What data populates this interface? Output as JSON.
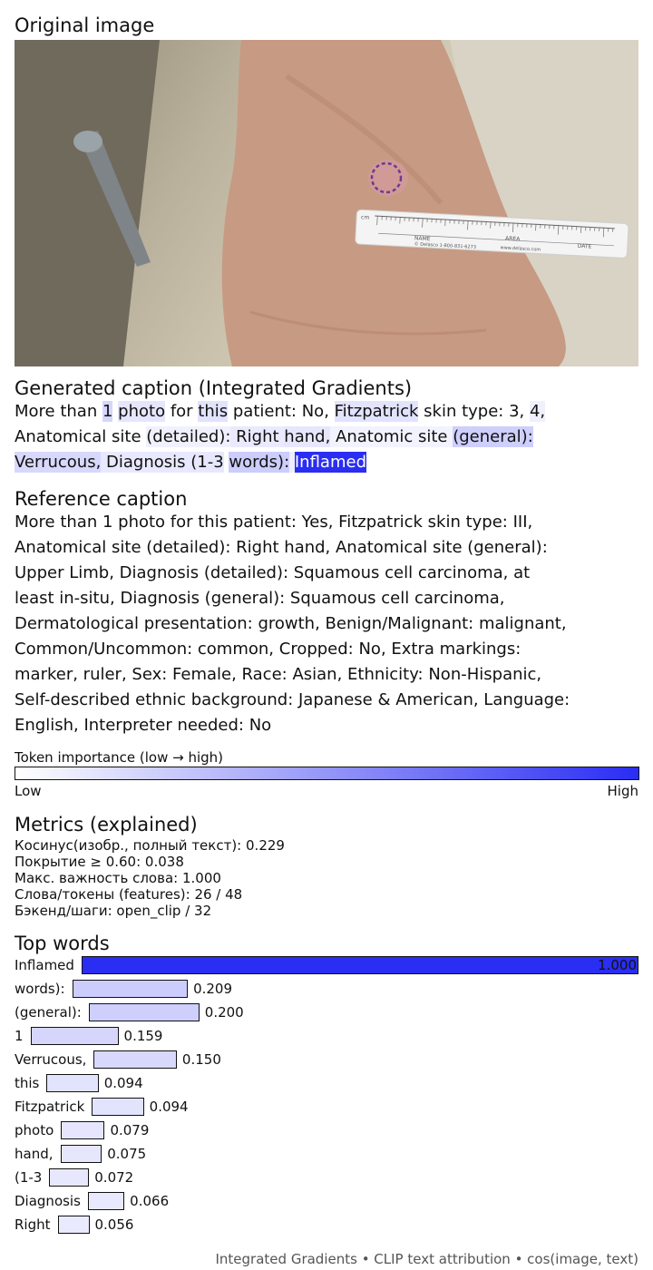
{
  "titles": {
    "original": "Original image",
    "generated": "Generated caption (Integrated Gradients)",
    "reference": "Reference caption",
    "metrics": "Metrics (explained)",
    "top_words": "Top words"
  },
  "generated_caption": {
    "lines": [
      [
        {
          "text": "More than ",
          "w": 0
        },
        {
          "text": "1",
          "w": 0.159
        },
        {
          "text": " ",
          "w": 0
        },
        {
          "text": "photo",
          "w": 0.079
        },
        {
          "text": " for ",
          "w": 0
        },
        {
          "text": "this",
          "w": 0.094
        },
        {
          "text": " patient: No, ",
          "w": 0
        },
        {
          "text": "Fitzpatrick",
          "w": 0.094
        },
        {
          "text": " skin type: 3, ",
          "w": 0
        },
        {
          "text": "4,",
          "w": 0.03
        }
      ],
      [
        {
          "text": "Anatomical site ",
          "w": 0
        },
        {
          "text": "(detailed):",
          "w": 0.02
        },
        {
          "text": " Right ",
          "w": 0.056
        },
        {
          "text": "hand,",
          "w": 0.075
        },
        {
          "text": " Anatomic site ",
          "w": 0.01
        },
        {
          "text": "(general):",
          "w": 0.2
        }
      ],
      [
        {
          "text": "Verrucous,",
          "w": 0.15
        },
        {
          "text": " Diagnosis ",
          "w": 0.066
        },
        {
          "text": "(1-3",
          "w": 0.072
        },
        {
          "text": " ",
          "w": 0
        },
        {
          "text": "words):",
          "w": 0.209
        },
        {
          "text": " ",
          "w": 0.04
        },
        {
          "text": "Inflamed",
          "w": 1.0
        }
      ]
    ]
  },
  "reference_caption": {
    "lines": [
      "More than 1 photo for this patient: Yes, Fitzpatrick skin type: III,",
      "Anatomical site (detailed): Right hand, Anatomical site (general):",
      "Upper Limb, Diagnosis (detailed): Squamous cell carcinoma, at",
      "least in-situ, Diagnosis (general): Squamous cell carcinoma,",
      "Dermatological presentation: growth, Benign/Malignant: malignant,",
      "Common/Uncommon: common, Cropped: No, Extra markings:",
      "marker, ruler, Sex: Female, Race: Asian, Ethnicity: Non-Hispanic,",
      "Self-described ethnic background: Japanese & American, Language:",
      "English, Interpreter needed: No"
    ]
  },
  "scale": {
    "label": "Token importance (low → high)",
    "low": "Low",
    "high": "High",
    "low_color": "#ffffff",
    "high_color": "#2a2df2"
  },
  "metrics": [
    "Косинус(изобр., полный текст): 0.229",
    "Покрытие ≥ 0.60: 0.038",
    "Макс. важность слова: 1.000",
    "Слова/токены (features): 26 / 48",
    "Бэкенд/шаги: open_clip / 32"
  ],
  "top_words": [
    {
      "word": "Inflamed",
      "value": 1.0,
      "label": "1.000"
    },
    {
      "word": "words):",
      "value": 0.209,
      "label": "0.209"
    },
    {
      "word": "(general):",
      "value": 0.2,
      "label": "0.200"
    },
    {
      "word": "1",
      "value": 0.159,
      "label": "0.159"
    },
    {
      "word": "Verrucous,",
      "value": 0.15,
      "label": "0.150"
    },
    {
      "word": "this",
      "value": 0.094,
      "label": "0.094"
    },
    {
      "word": "Fitzpatrick",
      "value": 0.094,
      "label": "0.094"
    },
    {
      "word": "photo",
      "value": 0.079,
      "label": "0.079"
    },
    {
      "word": "hand,",
      "value": 0.075,
      "label": "0.075"
    },
    {
      "word": "(1-3",
      "value": 0.072,
      "label": "0.072"
    },
    {
      "word": "Diagnosis",
      "value": 0.066,
      "label": "0.066"
    },
    {
      "word": "Right",
      "value": 0.056,
      "label": "0.056"
    }
  ],
  "ruler": {
    "unit": "cm",
    "name_label": "NAME",
    "area_label": "AREA",
    "date_label": "DATE",
    "brand": "© Delasco 1-800-831-6273",
    "url": "www.delasco.com"
  },
  "footer": "Integrated Gradients • CLIP text attribution • cos(image, text)"
}
